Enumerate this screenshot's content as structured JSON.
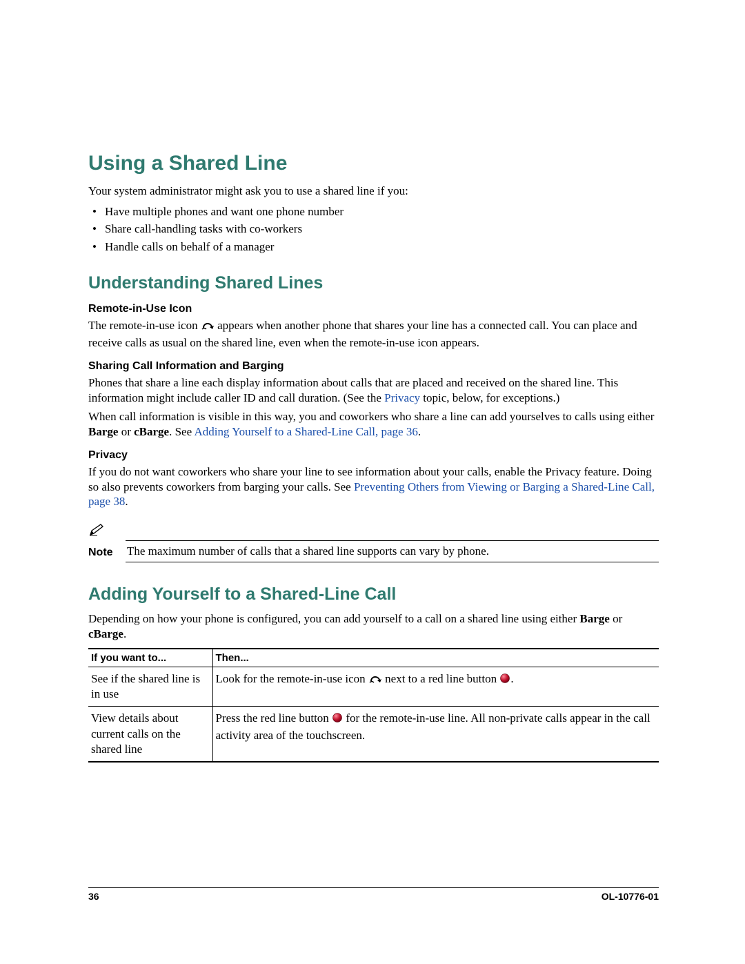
{
  "h1": "Using a Shared Line",
  "intro": "Your system administrator might ask you to use a shared line if you:",
  "bullets": [
    "Have multiple phones and want one phone number",
    "Share call-handling tasks with co-workers",
    "Handle calls on behalf of a manager"
  ],
  "h2a": "Understanding Shared Lines",
  "sec1": {
    "title": "Remote-in-Use Icon",
    "p1a": "The remote-in-use icon ",
    "p1b": " appears when another phone that shares your line has a connected call. You can place and receive calls as usual on the shared line, even when the remote-in-use icon appears."
  },
  "sec2": {
    "title": "Sharing Call Information and Barging",
    "p1a": "Phones that share a line each display information about calls that are placed and received on the shared line. This information might include caller ID and call duration. (See the ",
    "link1": "Privacy",
    "p1b": " topic, below, for exceptions.)",
    "p2a": "When call information is visible in this way, you and coworkers who share a line can add yourselves to calls using either ",
    "b1": "Barge",
    "p2b": " or ",
    "b2": "cBarge",
    "p2c": ". See ",
    "link2": "Adding Yourself to a Shared-Line Call, page 36",
    "p2d": "."
  },
  "sec3": {
    "title": "Privacy",
    "p1a": "If you do not want coworkers who share your line to see information about your calls, enable the Privacy feature. Doing so also prevents coworkers from barging your calls. See ",
    "link1": "Preventing Others from Viewing or Barging a Shared-Line Call, page 38",
    "p1b": "."
  },
  "note": {
    "label": "Note",
    "text": "The maximum number of calls that a shared line supports can vary by phone."
  },
  "h2b": "Adding Yourself to a Shared-Line Call",
  "adding_intro_a": "Depending on how your phone is configured, you can add yourself to a call on a shared line using either ",
  "adding_b1": "Barge",
  "adding_or": " or ",
  "adding_b2": "cBarge",
  "adding_period": ".",
  "table": {
    "th1": "If you want to...",
    "th2": "Then...",
    "r1c1": "See if the shared line is in use",
    "r1c2a": "Look for the remote-in-use icon ",
    "r1c2b": " next to a red line button ",
    "r1c2c": ".",
    "r2c1": "View details about current calls on the shared line",
    "r2c2a": "Press the red line button ",
    "r2c2b": " for the remote-in-use line. All non-private calls appear in the call activity area of the touchscreen."
  },
  "footer": {
    "page": "36",
    "docid": "OL-10776-01"
  }
}
